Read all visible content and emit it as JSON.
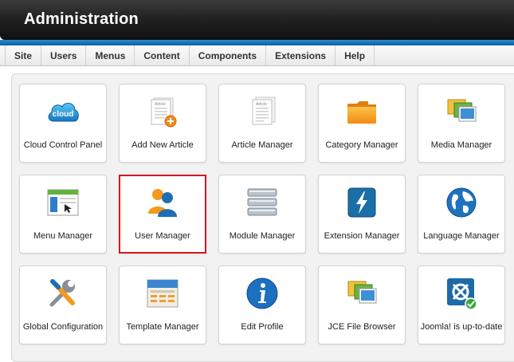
{
  "header": {
    "title": "Administration"
  },
  "menu": {
    "items": [
      "Site",
      "Users",
      "Menus",
      "Content",
      "Components",
      "Extensions",
      "Help"
    ]
  },
  "tiles": [
    {
      "label": "Cloud Control Panel",
      "icon": "cloud-icon"
    },
    {
      "label": "Add New Article",
      "icon": "add-article-icon"
    },
    {
      "label": "Article Manager",
      "icon": "article-icon"
    },
    {
      "label": "Category Manager",
      "icon": "folder-icon"
    },
    {
      "label": "Media Manager",
      "icon": "media-icon"
    },
    {
      "label": "Menu Manager",
      "icon": "menu-window-icon"
    },
    {
      "label": "User Manager",
      "icon": "users-icon",
      "selected": true
    },
    {
      "label": "Module Manager",
      "icon": "module-stack-icon"
    },
    {
      "label": "Extension Manager",
      "icon": "lightning-icon"
    },
    {
      "label": "Language Manager",
      "icon": "globe-icon"
    },
    {
      "label": "Global Configuration",
      "icon": "tools-icon"
    },
    {
      "label": "Template Manager",
      "icon": "template-icon"
    },
    {
      "label": "Edit Profile",
      "icon": "info-icon"
    },
    {
      "label": "JCE File Browser",
      "icon": "file-browser-icon"
    },
    {
      "label": "Joomla! is up-to-date",
      "icon": "joomla-check-icon"
    }
  ],
  "icon_text": {
    "cloud": "cloud",
    "article": "Article"
  },
  "colors": {
    "selected_border": "#d8161c",
    "header_blue": "#1c79bd"
  }
}
